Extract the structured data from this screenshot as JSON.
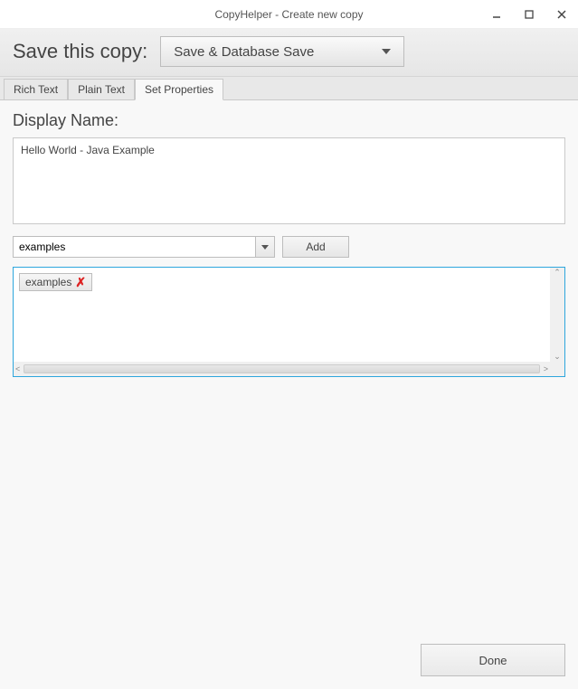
{
  "window": {
    "title": "CopyHelper - Create new copy"
  },
  "header": {
    "label": "Save this copy:",
    "save_mode": "Save & Database Save"
  },
  "tabs": [
    {
      "label": "Rich Text",
      "active": false
    },
    {
      "label": "Plain Text",
      "active": false
    },
    {
      "label": "Set Properties",
      "active": true
    }
  ],
  "properties": {
    "display_name_label": "Display Name:",
    "display_name_value": "Hello World - Java Example",
    "combo_value": "examples",
    "add_button": "Add",
    "tags": [
      {
        "label": "examples"
      }
    ]
  },
  "footer": {
    "done_button": "Done"
  }
}
